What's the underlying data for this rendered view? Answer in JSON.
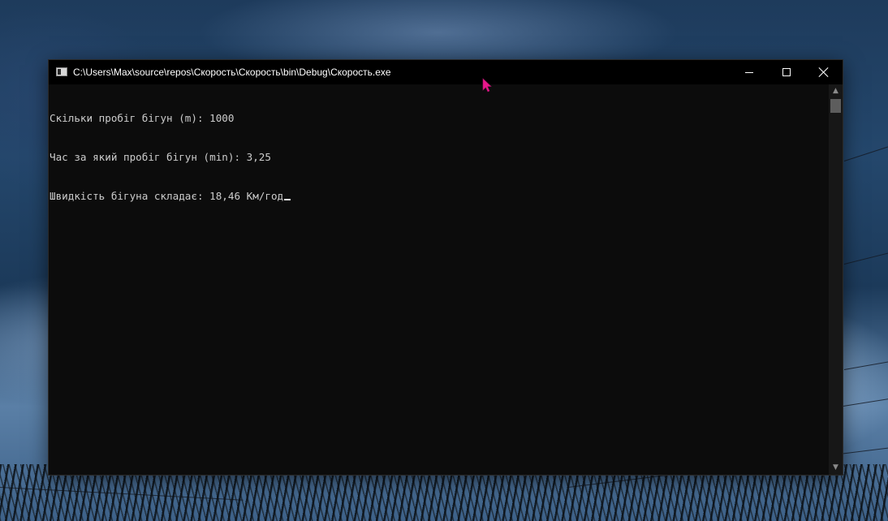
{
  "window": {
    "title": "C:\\Users\\Max\\source\\repos\\Скорость\\Скорость\\bin\\Debug\\Скорость.exe",
    "icon": "console-app-icon",
    "controls": {
      "minimize": "minimize-icon",
      "maximize": "maximize-icon",
      "close": "close-icon"
    }
  },
  "console": {
    "lines": [
      "Скільки пробіг бігун (m): 1000",
      "Час за який пробіг бігун (min): 3,25",
      "Швидкість бігуна складає: 18,46 Км/год"
    ],
    "background_color": "#0c0c0c",
    "text_color": "#cccccc"
  },
  "scrollbar": {
    "up_arrow": "▲",
    "down_arrow": "▼"
  },
  "pointer": {
    "icon": "mouse-pointer-icon",
    "color": "#e8178c"
  }
}
